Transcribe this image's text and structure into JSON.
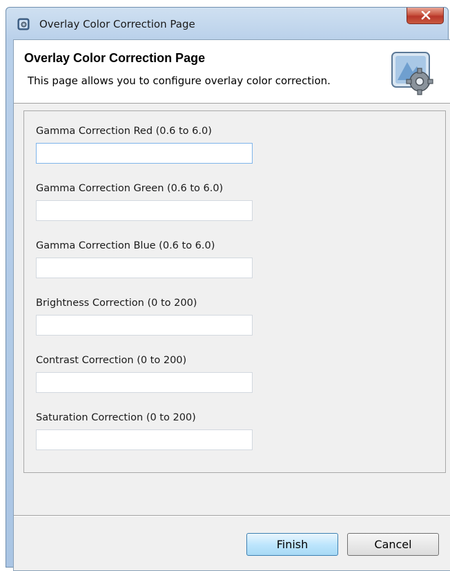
{
  "window": {
    "title": "Overlay Color Correction Page"
  },
  "header": {
    "title": "Overlay Color Correction Page",
    "description": "This page allows you to configure overlay color correction."
  },
  "fields": [
    {
      "label": "Gamma Correction Red (0.6 to 6.0)",
      "value": ""
    },
    {
      "label": "Gamma Correction Green (0.6 to 6.0)",
      "value": ""
    },
    {
      "label": "Gamma Correction Blue (0.6 to 6.0)",
      "value": ""
    },
    {
      "label": "Brightness Correction (0 to 200)",
      "value": ""
    },
    {
      "label": "Contrast Correction (0 to 200)",
      "value": ""
    },
    {
      "label": "Saturation Correction (0 to 200)",
      "value": ""
    }
  ],
  "buttons": {
    "finish": "Finish",
    "cancel": "Cancel"
  },
  "icons": {
    "app": "settings-window-icon",
    "header": "gear-settings-icon",
    "close": "close-icon"
  },
  "colors": {
    "title_bar": "#b9d0ea",
    "close_button": "#c95641",
    "focused_input_border": "#7eb4ea",
    "default_button": "#bee6fd"
  }
}
